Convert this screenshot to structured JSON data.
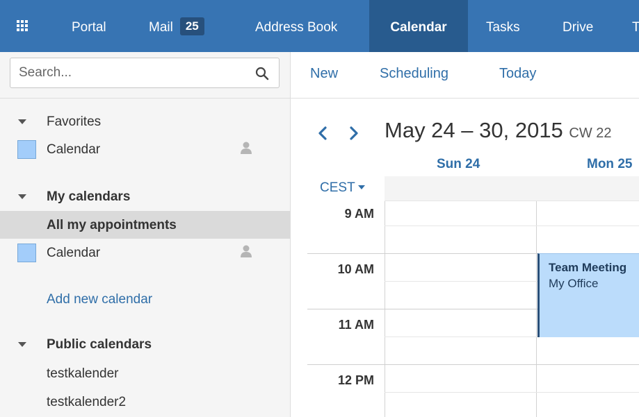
{
  "nav": {
    "items": [
      {
        "label": "Portal"
      },
      {
        "label": "Mail",
        "badge": "25"
      },
      {
        "label": "Address Book"
      },
      {
        "label": "Calendar",
        "active": true
      },
      {
        "label": "Tasks"
      },
      {
        "label": "Drive"
      },
      {
        "label": "T"
      }
    ],
    "active_color": "#285b8e",
    "bar_color": "#3774b3"
  },
  "search": {
    "placeholder": "Search...",
    "value": ""
  },
  "sidebar": {
    "favorites": {
      "label": "Favorites",
      "items": [
        {
          "label": "Calendar",
          "color": "#a3cdfa",
          "icon": "person-icon"
        }
      ]
    },
    "my_calendars": {
      "label": "My calendars",
      "all_label": "All my appointments",
      "items": [
        {
          "label": "Calendar",
          "color": "#a3cdfa",
          "icon": "person-icon"
        }
      ],
      "add_label": "Add new calendar"
    },
    "public_calendars": {
      "label": "Public calendars",
      "items": [
        {
          "label": "testkalender"
        },
        {
          "label": "testkalender2"
        }
      ]
    }
  },
  "toolbar": {
    "new": "New",
    "scheduling": "Scheduling",
    "today": "Today"
  },
  "date_range": {
    "title": "May 24 – 30, 2015",
    "cw": "CW 22"
  },
  "days": [
    "Sun 24",
    "Mon 25"
  ],
  "timezone": "CEST",
  "hours": [
    "9 AM",
    "10 AM",
    "11 AM",
    "12 PM"
  ],
  "appointment": {
    "title": "Team Meeting",
    "location": "My Office",
    "color": "#bbdcfb"
  }
}
